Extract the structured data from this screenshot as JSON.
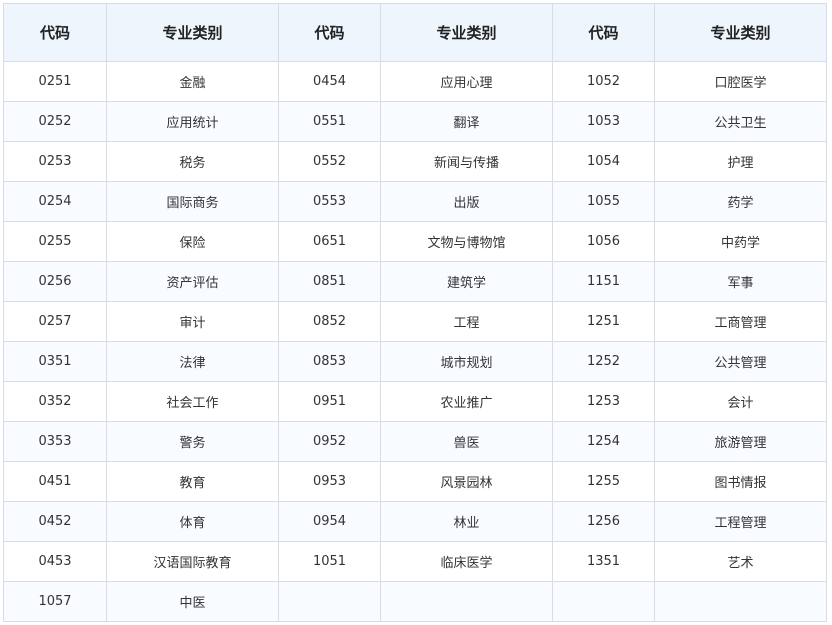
{
  "headers": [
    "代码",
    "专业类别",
    "代码",
    "专业类别",
    "代码",
    "专业类别"
  ],
  "rows": [
    [
      "0251",
      "金融",
      "0454",
      "应用心理",
      "1052",
      "口腔医学"
    ],
    [
      "0252",
      "应用统计",
      "0551",
      "翻译",
      "1053",
      "公共卫生"
    ],
    [
      "0253",
      "税务",
      "0552",
      "新闻与传播",
      "1054",
      "护理"
    ],
    [
      "0254",
      "国际商务",
      "0553",
      "出版",
      "1055",
      "药学"
    ],
    [
      "0255",
      "保险",
      "0651",
      "文物与博物馆",
      "1056",
      "中药学"
    ],
    [
      "0256",
      "资产评估",
      "0851",
      "建筑学",
      "1151",
      "军事"
    ],
    [
      "0257",
      "审计",
      "0852",
      "工程",
      "1251",
      "工商管理"
    ],
    [
      "0351",
      "法律",
      "0853",
      "城市规划",
      "1252",
      "公共管理"
    ],
    [
      "0352",
      "社会工作",
      "0951",
      "农业推广",
      "1253",
      "会计"
    ],
    [
      "0353",
      "警务",
      "0952",
      "兽医",
      "1254",
      "旅游管理"
    ],
    [
      "0451",
      "教育",
      "0953",
      "风景园林",
      "1255",
      "图书情报"
    ],
    [
      "0452",
      "体育",
      "0954",
      "林业",
      "1256",
      "工程管理"
    ],
    [
      "0453",
      "汉语国际教育",
      "1051",
      "临床医学",
      "1351",
      "艺术"
    ],
    [
      "1057",
      "中医",
      "",
      "",
      "",
      ""
    ]
  ]
}
